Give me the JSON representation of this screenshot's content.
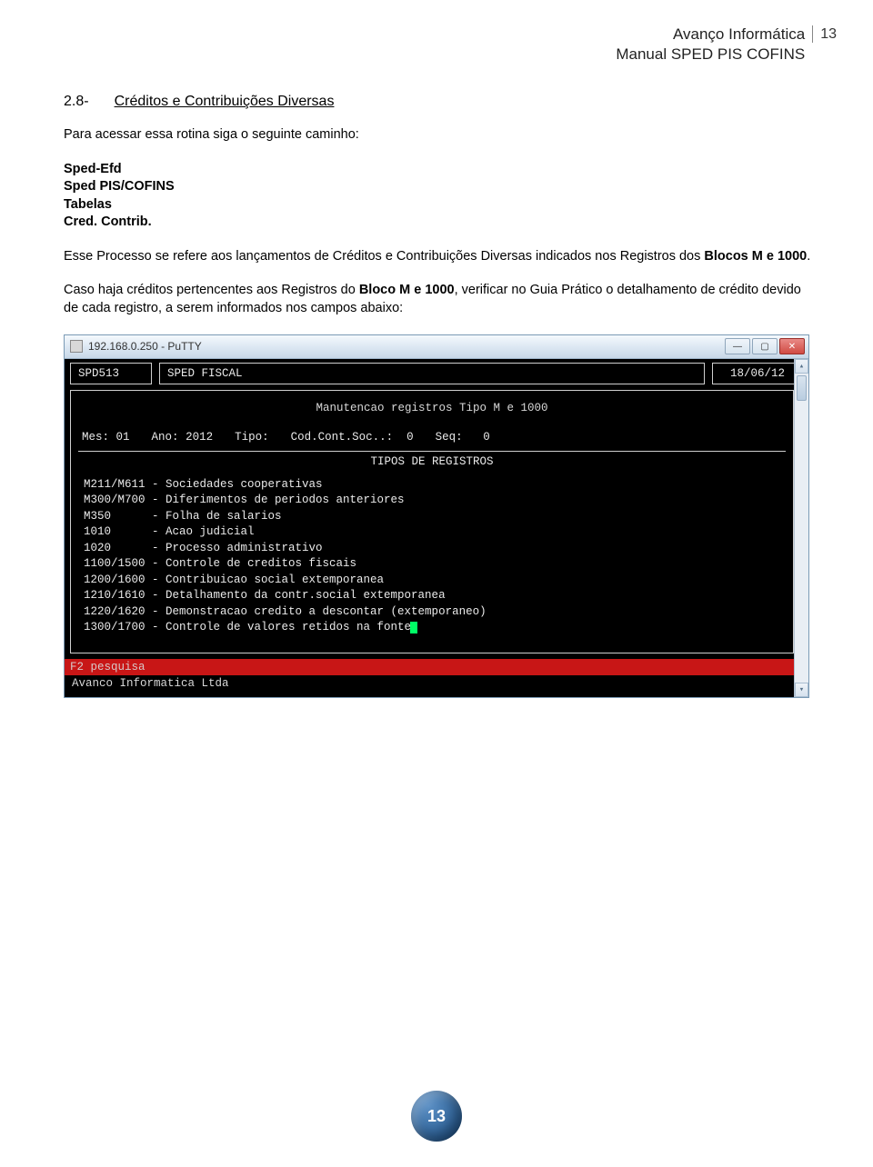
{
  "header": {
    "brand": "Avanço Informática",
    "manual": "Manual SPED PIS COFINS",
    "page_number_top": "13"
  },
  "section": {
    "number": "2.8-",
    "title": "Créditos e Contribuições Diversas"
  },
  "intro": "Para acessar essa rotina siga o seguinte caminho:",
  "path": {
    "l1": "Sped-Efd",
    "l2": "Sped PIS/COFINS",
    "l3": "Tabelas",
    "l4": "Cred. Contrib."
  },
  "body1_pre": "Esse Processo se refere aos lançamentos de Créditos e Contribuições Diversas indicados nos Registros dos ",
  "body1_bold": "Blocos M e 1000",
  "body1_post": ".",
  "body2_pre": "Caso haja créditos pertencentes aos Registros do ",
  "body2_bold": "Bloco M e 1000",
  "body2_post": ", verificar no Guia Prático o detalhamento de crédito devido de cada registro, a serem informados nos campos abaixo:",
  "window": {
    "title": "192.168.0.250 - PuTTY",
    "header": {
      "code": "SPD513",
      "label": "SPED FISCAL",
      "date": "18/06/12"
    },
    "main_title": "Manutencao registros Tipo M e 1000",
    "fields": {
      "mes_label": "Mes:",
      "mes_val": "01",
      "ano_label": "Ano:",
      "ano_val": "2012",
      "tipo_label": "Tipo:",
      "cod_label": "Cod.Cont.Soc..:",
      "cod_val": "0",
      "seq_label": "Seq:",
      "seq_val": "0"
    },
    "reg_heading": "TIPOS DE REGISTROS",
    "reg_lines": [
      "M211/M611 - Sociedades cooperativas",
      "M300/M700 - Diferimentos de periodos anteriores",
      "M350      - Folha de salarios",
      "1010      - Acao judicial",
      "1020      - Processo administrativo",
      "1100/1500 - Controle de creditos fiscais",
      "1200/1600 - Contribuicao social extemporanea",
      "1210/1610 - Detalhamento da contr.social extemporanea",
      "1220/1620 - Demonstracao credito a descontar (extemporaneo)",
      "1300/1700 - Controle de valores retidos na fonte"
    ],
    "footer_msg": "F2 pesquisa",
    "footer_company": "Avanco Informatica Ltda"
  },
  "page_footer": "13"
}
